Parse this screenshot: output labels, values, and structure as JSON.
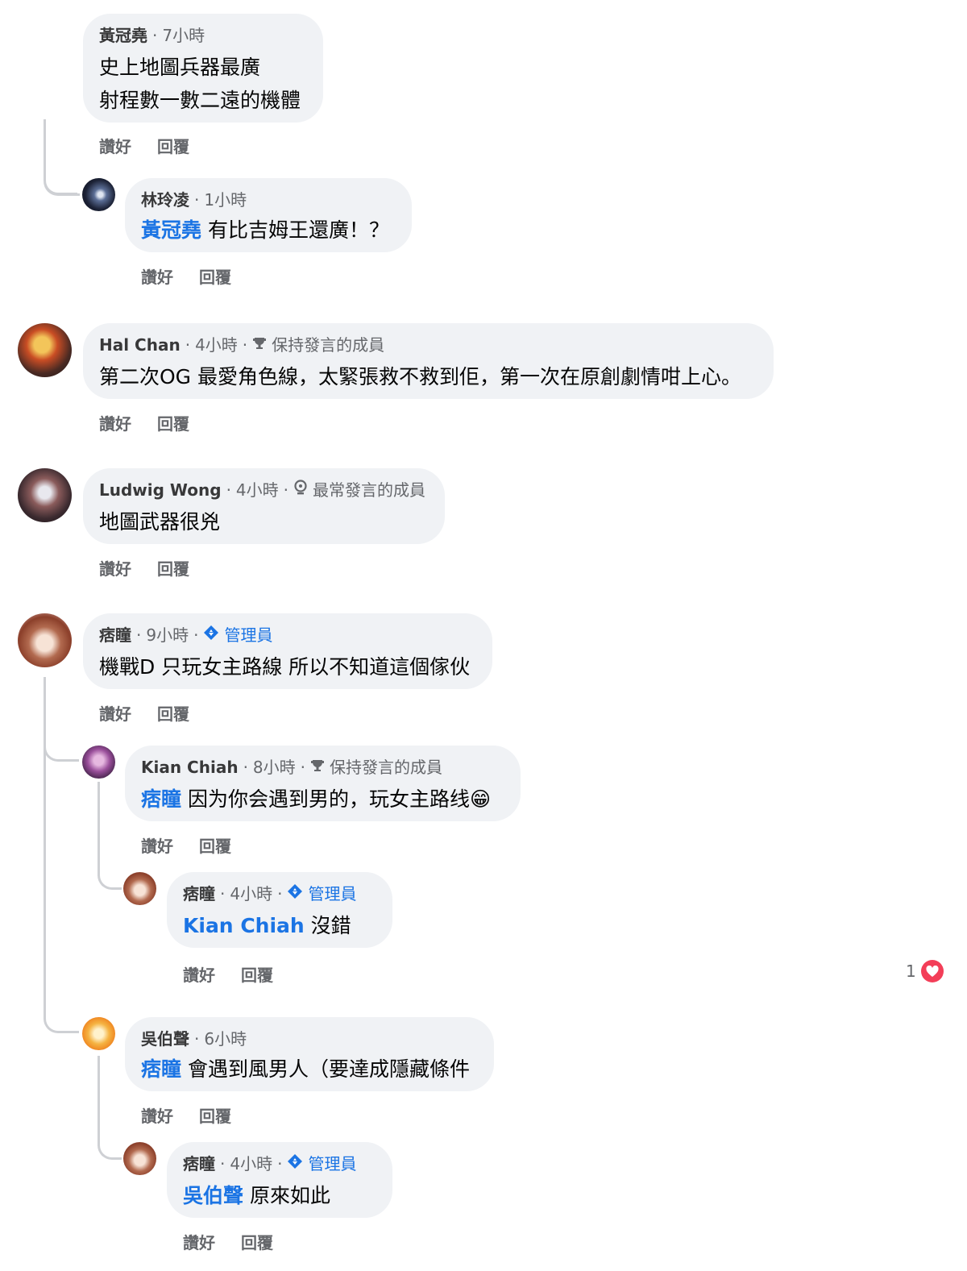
{
  "comments": [
    {
      "author": "黃冠堯",
      "time": "7小時",
      "lines": [
        "史上地圖兵器最廣",
        "射程數一數二遠的機體"
      ],
      "actions": [
        "讚好",
        "回覆"
      ]
    },
    {
      "author": "林玲凌",
      "time": "1小時",
      "mention": "黃冠堯",
      "text": "有比吉姆王還廣！？",
      "actions": [
        "讚好",
        "回覆"
      ]
    },
    {
      "author": "Hal Chan",
      "time": "4小時",
      "badge": "保持發言的成員",
      "text": "第二次OG 最愛角色線，太緊張救不救到佢，第一次在原創劇情咁上心。",
      "actions": [
        "讚好",
        "回覆"
      ]
    },
    {
      "author": "Ludwig Wong",
      "time": "4小時",
      "badge": "最常發言的成員",
      "text": "地圖武器很兇",
      "actions": [
        "讚好",
        "回覆"
      ]
    },
    {
      "author": "痞瞳",
      "time": "9小時",
      "badge": "管理員",
      "text": "機戰D 只玩女主路線 所以不知道這個傢伙",
      "actions": [
        "讚好",
        "回覆"
      ]
    },
    {
      "author": "Kian  Chiah",
      "time": "8小時",
      "badge": "保持發言的成員",
      "mention": "痞瞳",
      "text": "因为你会遇到男的，玩女主路线😁",
      "actions": [
        "讚好",
        "回覆"
      ]
    },
    {
      "author": "痞瞳",
      "time": "4小時",
      "badge": "管理員",
      "mention": "Kian  Chiah",
      "text": "沒錯",
      "actions": [
        "讚好",
        "回覆"
      ],
      "reaction_count": "1"
    },
    {
      "author": "吳伯聲",
      "time": "6小時",
      "mention": "痞瞳",
      "text": "會遇到風男人（要達成隱藏條件",
      "actions": [
        "讚好",
        "回覆"
      ]
    },
    {
      "author": "痞瞳",
      "time": "4小時",
      "badge": "管理員",
      "mention": "吳伯聲",
      "text": "原來如此",
      "actions": [
        "讚好",
        "回覆"
      ]
    }
  ],
  "icons": {
    "trophy": "trophy-icon",
    "member": "member-icon",
    "admin": "admin-shield-icon",
    "reaction": "heart-icon"
  },
  "colors": {
    "mention": "#1b74e4",
    "bubble": "#f0f2f5",
    "reaction": "#f33e58"
  }
}
